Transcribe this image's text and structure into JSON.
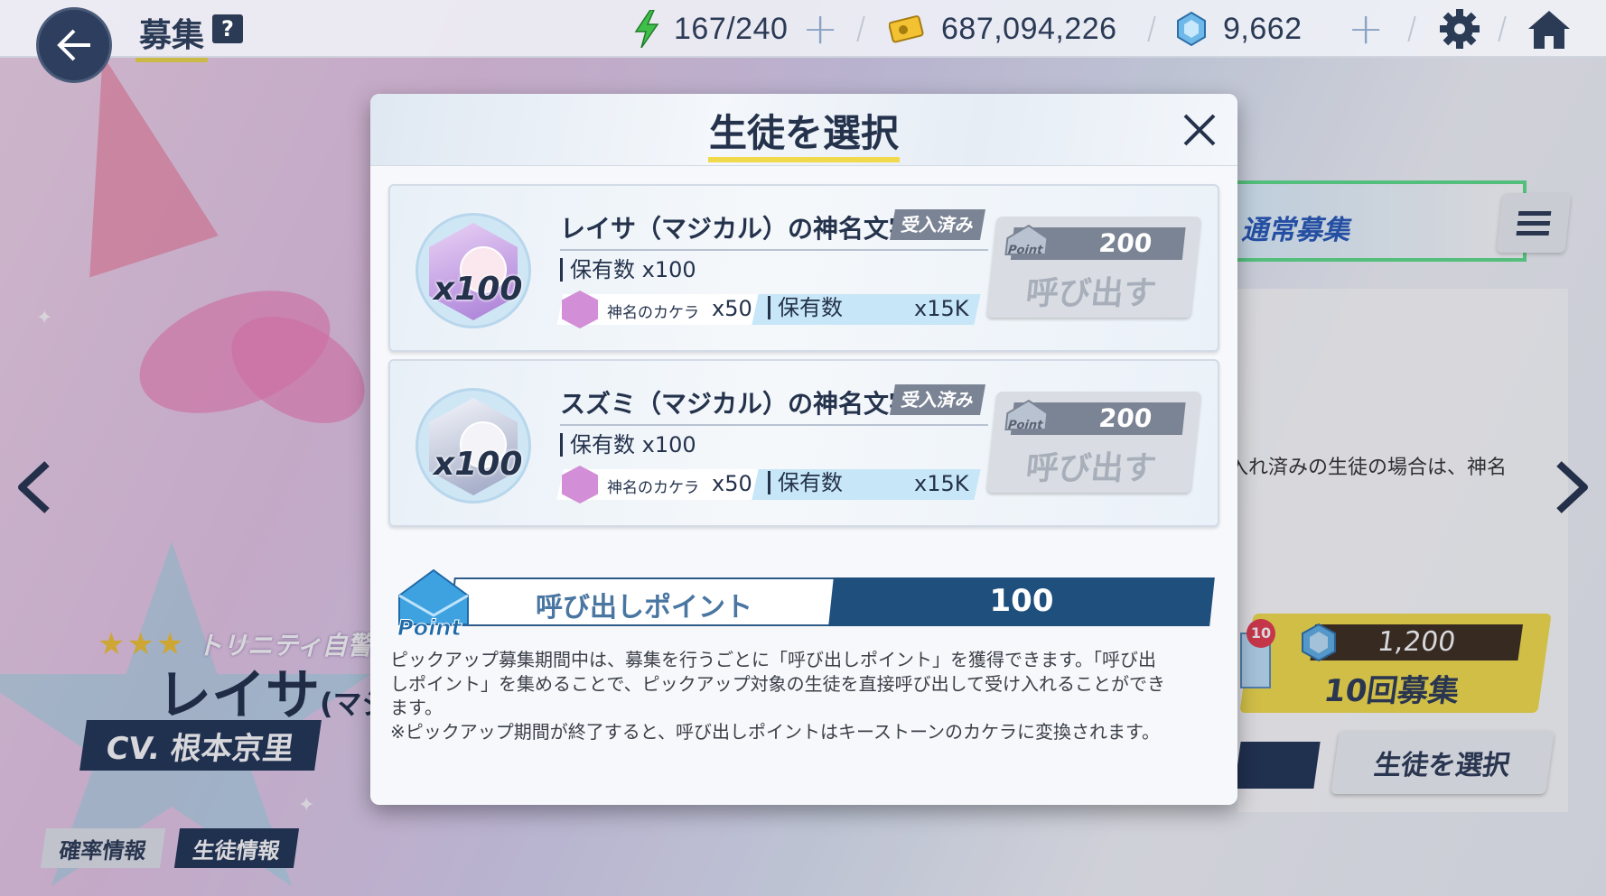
{
  "topbar": {
    "title": "募集",
    "help": "?",
    "stamina": "167/240",
    "credits": "687,094,226",
    "gems": "9,662"
  },
  "background": {
    "tab_banner": "通常募集",
    "info_text": "入れ済みの生徒の場合は、神名",
    "ten_pull_cost": "1,200",
    "ten_pull_label": "10回募集",
    "ten_badge": "10",
    "select_student": "生徒を選択",
    "school": "トリニティ自警団",
    "character_name": "レイサ",
    "character_suffix": "(マジ",
    "cv": "CV. 根本京里",
    "tabs": [
      "確率情報",
      "生徒情報"
    ]
  },
  "modal": {
    "title": "生徒を選択",
    "cards": [
      {
        "name": "レイサ（マジカル）の神名文字",
        "status": "受入済み",
        "owned": "保有数 x100",
        "qty": "x100",
        "material": "神名のカケラ",
        "material_count": "x50",
        "material_owned_label": "保有数",
        "material_owned": "x15K",
        "cost_icon": "Point",
        "cost": "200",
        "button": "呼び出す"
      },
      {
        "name": "スズミ（マジカル）の神名文字",
        "status": "受入済み",
        "owned": "保有数 x100",
        "qty": "x100",
        "material": "神名のカケラ",
        "material_count": "x50",
        "material_owned_label": "保有数",
        "material_owned": "x15K",
        "cost_icon": "Point",
        "cost": "200",
        "button": "呼び出す"
      }
    ],
    "points": {
      "icon": "Point",
      "label": "呼び出しポイント",
      "value": "100"
    },
    "description": [
      "ピックアップ募集期間中は、募集を行うごとに「呼び出しポイント」を獲得できます。「呼び出",
      "しポイント」を集めることで、ピックアップ対象の生徒を直接呼び出して受け入れることができ",
      "ます。",
      "※ピックアップ期間が終了すると、呼び出しポイントはキーストーンのカケラに変換されます。"
    ]
  },
  "colors": {
    "navy": "#24324c",
    "accent_yellow": "#f0d94a",
    "point_blue": "#1f4f7d"
  }
}
